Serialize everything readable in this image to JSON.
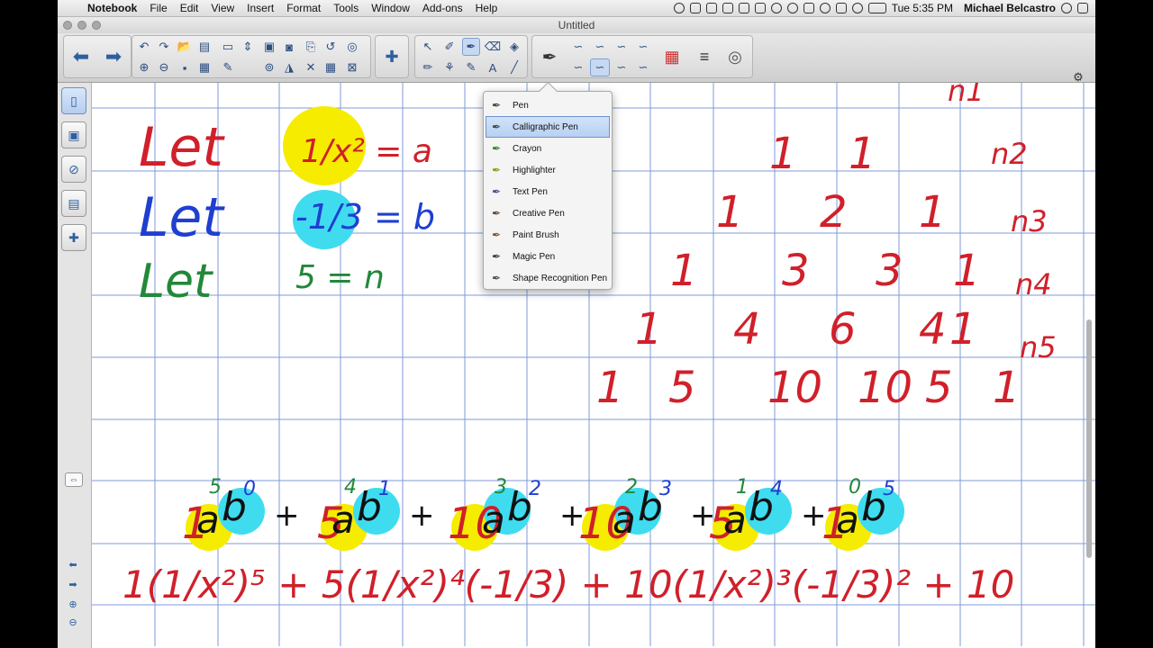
{
  "menubar": {
    "app_name": "Notebook",
    "items": [
      "File",
      "Edit",
      "View",
      "Insert",
      "Format",
      "Tools",
      "Window",
      "Add-ons",
      "Help"
    ],
    "clock": "Tue 5:35 PM",
    "user": "Michael Belcastro"
  },
  "window": {
    "title": "Untitled"
  },
  "pen_menu": {
    "items": [
      {
        "label": "Pen",
        "icon": "pen-icon",
        "color": "#4a4a4a"
      },
      {
        "label": "Calligraphic Pen",
        "icon": "calligraphic-pen-icon",
        "color": "#4a4a4a"
      },
      {
        "label": "Crayon",
        "icon": "crayon-icon",
        "color": "#2e8b2e"
      },
      {
        "label": "Highlighter",
        "icon": "highlighter-icon",
        "color": "#8aa020"
      },
      {
        "label": "Text Pen",
        "icon": "text-pen-icon",
        "color": "#5a4a8a"
      },
      {
        "label": "Creative Pen",
        "icon": "creative-pen-icon",
        "color": "#6a4a2a"
      },
      {
        "label": "Paint Brush",
        "icon": "paint-brush-icon",
        "color": "#8a5a20"
      },
      {
        "label": "Magic Pen",
        "icon": "magic-pen-icon",
        "color": "#444"
      },
      {
        "label": "Shape Recognition Pen",
        "icon": "shape-recognition-pen-icon",
        "color": "#555"
      }
    ],
    "selected": "Calligraphic Pen"
  },
  "canvas": {
    "let_lines": [
      {
        "word": "Let",
        "expr": "1/x² = a",
        "color": "#d0202a"
      },
      {
        "word": "Let",
        "expr": "-1/3 = b",
        "color": "#1f3fd0"
      },
      {
        "word": "Let",
        "expr": "5 = n",
        "color": "#22883a"
      }
    ],
    "triangle_rows": [
      {
        "label": "n1",
        "values": [
          "1",
          "1"
        ]
      },
      {
        "label": "n2",
        "values": [
          "1",
          "2",
          "1"
        ]
      },
      {
        "label": "n3",
        "values": [
          "1",
          "3",
          "3",
          "1"
        ]
      },
      {
        "label": "n4",
        "values": [
          "1",
          "4",
          "6",
          "4",
          "1"
        ]
      },
      {
        "label": "n5",
        "values": [
          "1",
          "5",
          "10",
          "10",
          "5",
          "1"
        ]
      }
    ],
    "expansion": [
      {
        "coef": "1",
        "a_exp": "5",
        "b_exp": "0"
      },
      {
        "coef": "5",
        "a_exp": "4",
        "b_exp": "1"
      },
      {
        "coef": "10",
        "a_exp": "3",
        "b_exp": "2"
      },
      {
        "coef": "10",
        "a_exp": "2",
        "b_exp": "3"
      },
      {
        "coef": "5",
        "a_exp": "1",
        "b_exp": "4"
      },
      {
        "coef": "1",
        "a_exp": "0",
        "b_exp": "5"
      }
    ],
    "substitution": "1(1/x²)⁵ + 5(1/x²)⁴(-1/3) + 10(1/x²)³(-1/3)² + 10"
  },
  "colors": {
    "red_ink": "#d0202a",
    "blue_ink": "#1f3fd0",
    "green_ink": "#22883a",
    "black_ink": "#111111",
    "yellow_hl": "#f5ec00",
    "cyan_hl": "#3fdcf0",
    "grid": "#7f9ad8"
  }
}
